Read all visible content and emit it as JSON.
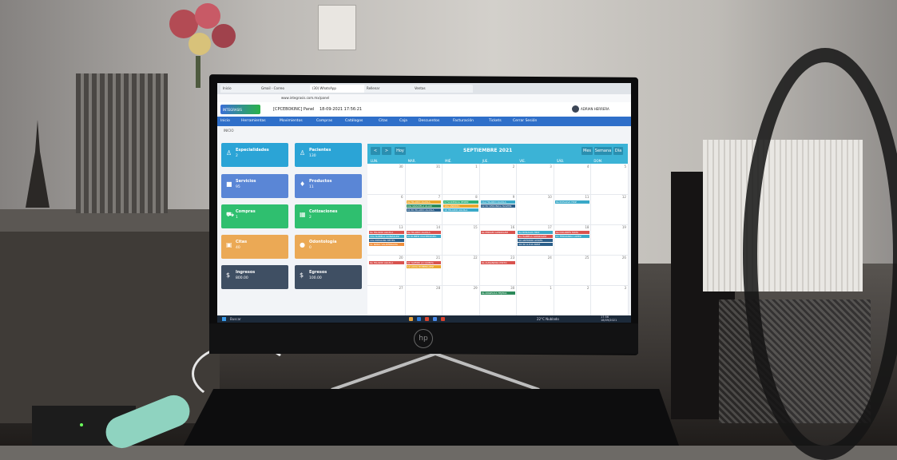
{
  "browser": {
    "tabs": [
      "Inicio",
      "Gmail - Correo",
      "(30) WhatsApp",
      "Rellenar",
      "Ventas"
    ],
    "url": "www.integrasis.com.mx/panel"
  },
  "header": {
    "logo_text": "INTEGRASIS",
    "company": "[CPCEBOKINC] Panel",
    "datetime": "18-09-2021 17:56:21",
    "user": "ADRIAN HERRERA"
  },
  "nav": [
    "Inicio",
    "Herramientas",
    "Movimientos",
    "Compras",
    "Catálogos",
    "Citas",
    "Caja",
    "Descuentos",
    "Facturación",
    "Tickets",
    "Cerrar Sesión"
  ],
  "breadcrumb": "INICIO",
  "cards": [
    {
      "title": "Especialidades",
      "value": "2",
      "color": "#2ba4d6",
      "icon": "user-icon"
    },
    {
      "title": "Pacientes",
      "value": "130",
      "color": "#2ba4d6",
      "icon": "user-icon"
    },
    {
      "title": "Servicios",
      "value": "95",
      "color": "#5a86d6",
      "icon": "folder-icon"
    },
    {
      "title": "Productos",
      "value": "11",
      "color": "#5a86d6",
      "icon": "box-icon"
    },
    {
      "title": "Compras",
      "value": "1",
      "color": "#2fbf6f",
      "icon": "cart-icon"
    },
    {
      "title": "Cotizaciones",
      "value": "2",
      "color": "#2fbf6f",
      "icon": "doc-icon"
    },
    {
      "title": "Citas",
      "value": "40",
      "color": "#eba955",
      "icon": "calendar-icon"
    },
    {
      "title": "Odontología",
      "value": "0",
      "color": "#eba955",
      "icon": "tooth-icon"
    },
    {
      "title": "Ingresos",
      "value": "800.00",
      "color": "#3f4f63",
      "icon": "dollar-icon"
    },
    {
      "title": "Egresos",
      "value": "100.00",
      "color": "#3f4f63",
      "icon": "dollar-icon"
    }
  ],
  "calendar": {
    "title": "SEPTIEMBRE 2021",
    "prev": "<",
    "next": ">",
    "today": "Hoy",
    "views": [
      "Mes",
      "Semana",
      "Día"
    ],
    "days": [
      "LUN.",
      "MAR.",
      "MIÉ.",
      "JUE.",
      "VIE.",
      "SÁB.",
      "DOM."
    ],
    "dates": [
      "30",
      "31",
      "1",
      "2",
      "3",
      "4",
      "5",
      "6",
      "7",
      "8",
      "9",
      "10",
      "11",
      "12",
      "13",
      "14",
      "15",
      "16",
      "17",
      "18",
      "19",
      "20",
      "21",
      "22",
      "23",
      "24",
      "25",
      "26",
      "27",
      "28",
      "29",
      "30",
      "1",
      "2",
      "3"
    ],
    "events": [
      {
        "cell": 8,
        "row": 0,
        "text": "9a HILARIO AGUILA",
        "color": "#e9a72e"
      },
      {
        "cell": 8,
        "row": 1,
        "text": "10a GRACIELA ALAIX",
        "color": "#2c8a5a"
      },
      {
        "cell": 8,
        "row": 2,
        "text": "10:30 HILARIO AGUILA",
        "color": "#2c5f8a"
      },
      {
        "cell": 9,
        "row": 0,
        "text": "9 FLORENCIA PEREZ",
        "color": "#2fb079"
      },
      {
        "cell": 9,
        "row": 1,
        "text": "10a ANDREA",
        "color": "#e9a72e"
      },
      {
        "cell": 9,
        "row": 2,
        "text": "10 HILARIO AGUILA",
        "color": "#3aa9c8"
      },
      {
        "cell": 10,
        "row": 0,
        "text": "11a HILARIO AGUILA",
        "color": "#3aa9c8"
      },
      {
        "cell": 10,
        "row": 1,
        "text": "12:30 VERONICA MARTIN",
        "color": "#2c5f8a"
      },
      {
        "cell": 12,
        "row": 0,
        "text": "9a ROSALVA HDZ",
        "color": "#3aa9c8"
      },
      {
        "cell": 14,
        "row": 0,
        "text": "9a HILARIO AGUILA",
        "color": "#d9534f"
      },
      {
        "cell": 14,
        "row": 1,
        "text": "10a ISABELA GONZALEZ",
        "color": "#3aa9c8"
      },
      {
        "cell": 14,
        "row": 2,
        "text": "10a ROSALBA REYES",
        "color": "#2c5f8a"
      },
      {
        "cell": 14,
        "row": 3,
        "text": "11 NORA VALDERRAMA",
        "color": "#ef8e3b"
      },
      {
        "cell": 15,
        "row": 0,
        "text": "9a HILARIO AGUILA",
        "color": "#d9534f"
      },
      {
        "cell": 15,
        "row": 1,
        "text": "10 RUBEN VALDERRAMA",
        "color": "#3aa9c8"
      },
      {
        "cell": 17,
        "row": 0,
        "text": "9a MIRIAM GONZALEZ",
        "color": "#d9534f"
      },
      {
        "cell": 18,
        "row": 0,
        "text": "9a ROSALVA HDZ",
        "color": "#3aa9c8"
      },
      {
        "cell": 18,
        "row": 1,
        "text": "9a ISABELA GONZALEZ",
        "color": "#d9534f"
      },
      {
        "cell": 18,
        "row": 2,
        "text": "10 ANTONIO AVILES",
        "color": "#2c5f8a"
      },
      {
        "cell": 18,
        "row": 3,
        "text": "10:30 LUCIA PAEZ",
        "color": "#2c5f8a"
      },
      {
        "cell": 19,
        "row": 0,
        "text": "9a DOLORES MATA",
        "color": "#d9534f"
      },
      {
        "cell": 19,
        "row": 1,
        "text": "11 FERNANDA LOPEZ",
        "color": "#3aa9c8"
      },
      {
        "cell": 21,
        "row": 0,
        "text": "9a HILARIO AGUILA",
        "color": "#d9534f"
      },
      {
        "cell": 22,
        "row": 0,
        "text": "10 YAZMIN LA QUINTA",
        "color": "#d9534f"
      },
      {
        "cell": 22,
        "row": 1,
        "text": "11 LUCIA DOMINGUEZ",
        "color": "#e9a72e"
      },
      {
        "cell": 24,
        "row": 0,
        "text": "9a ALEJANDRA PINTO",
        "color": "#d9534f"
      },
      {
        "cell": 31,
        "row": 0,
        "text": "9a ANGELICA TEJEDA",
        "color": "#2c8a5a"
      }
    ]
  },
  "taskbar": {
    "search": "Buscar",
    "weather": "22°C Nublado",
    "time": "17:56",
    "date": "18/09/2021"
  },
  "colors": {
    "nav": "#2f6fc9",
    "calendar_bar": "#3bb3d6",
    "taskbar": "#1c2a3a"
  }
}
